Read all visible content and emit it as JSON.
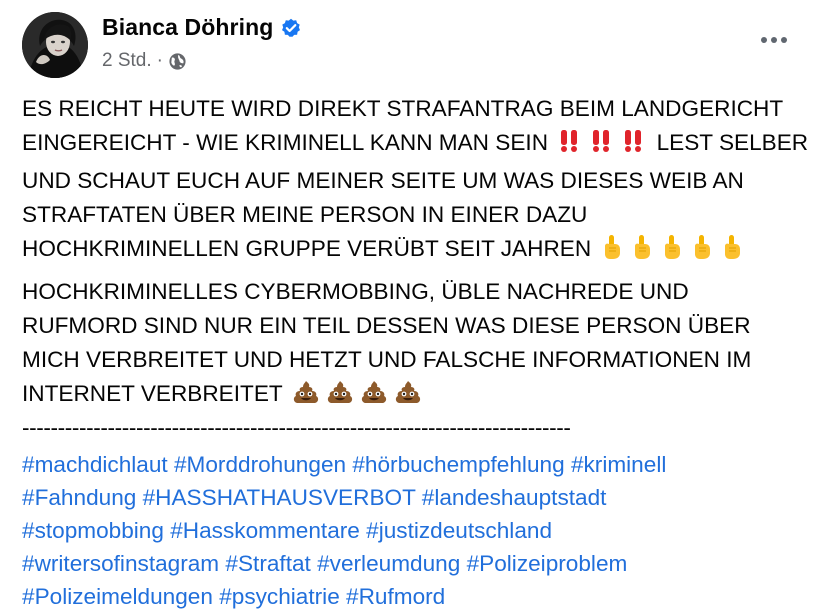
{
  "post": {
    "author": "Bianca Döhring",
    "time": "2 Std.",
    "separator": "·",
    "paragraph1": [
      "ES REICHT HEUTE WIRD DIREKT STRAFANTRAG BEIM LANDGERICHT",
      "EINGEREICHT - WIE KRIMINELL KANN MAN SEIN",
      "LEST SELBER",
      "UND SCHAUT EUCH AUF MEINER SEITE UM WAS DIESES WEIB AN",
      "STRAFTATEN ÜBER MEINE PERSON IN EINER DAZU",
      "HOCHKRIMINELLEN GRUPPE VERÜBT SEIT JAHREN"
    ],
    "paragraph2": [
      "HOCHKRIMINELLES CYBERMOBBING, ÜBLE NACHREDE UND",
      "RUFMORD SIND NUR EIN TEIL DESSEN WAS DIESE PERSON ÜBER",
      "MICH VERBREITET UND HETZT UND FALSCHE INFORMATIONEN IM",
      "INTERNET VERBREITET"
    ],
    "divider": "-----------------------------------------------------------------------------",
    "hashtags": [
      [
        "#machdichlaut",
        "#Morddrohungen",
        "#hörbuchempfehlung",
        "#kriminell"
      ],
      [
        "#Fahndung",
        "#HASSHATHAUSVERBOT",
        "#landeshauptstadt"
      ],
      [
        "#stopmobbing",
        "#Hasskommentare",
        "#justizdeutschland"
      ],
      [
        "#writersofinstagram",
        "#Straftat",
        "#verleumdung",
        "#Polizeiproblem"
      ],
      [
        "#Polizeimeldungen",
        "#psychiatrie",
        "#Rufmord"
      ]
    ],
    "icons": {
      "verified": "verified-badge-icon",
      "privacy": "globe-icon",
      "more": "more-options-icon",
      "double_exclamation": "double-exclamation-emoji",
      "pointing_up": "pointing-up-emoji",
      "pile_of_poo": "pile-of-poo-emoji"
    },
    "colors": {
      "hashtag": "#216fdb",
      "verified": "#1877f2",
      "secondary": "#65676b",
      "text": "#050505"
    }
  }
}
